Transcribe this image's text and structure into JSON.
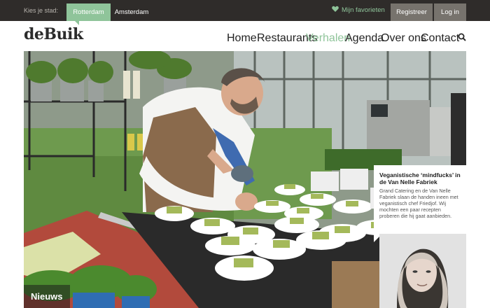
{
  "topbar": {
    "city_label": "Kies je stad:",
    "cities": [
      {
        "label": "Rotterdam",
        "active": true
      },
      {
        "label": "Amsterdam",
        "active": false
      }
    ],
    "favorites_label": "Mijn favorieten",
    "register_label": "Registreer",
    "login_label": "Log in"
  },
  "header": {
    "logo": "deBuik",
    "nav": [
      {
        "label": "Home",
        "active": false
      },
      {
        "label": "Restaurants",
        "active": false
      },
      {
        "label": "Verhalen",
        "active": true
      },
      {
        "label": "Agenda",
        "active": false
      },
      {
        "label": "Over ons",
        "active": false
      },
      {
        "label": "Contact",
        "active": false
      }
    ],
    "search_icon": "search-icon"
  },
  "hero": {
    "category_label": "Nieuws"
  },
  "story": {
    "title": "Veganistische ‘mindfucks’ in de Van Nelle Fabriek",
    "text": "Grand Catering en de Van Nelle Fabriek slaan de handen ineen met veganistisch chef Friedjof. Wij mochten een paar recepten proberen die hij gaat aanbieden."
  },
  "colors": {
    "accent": "#8fc49a",
    "topbar": "#2f2c2a",
    "button": "#77736d"
  }
}
